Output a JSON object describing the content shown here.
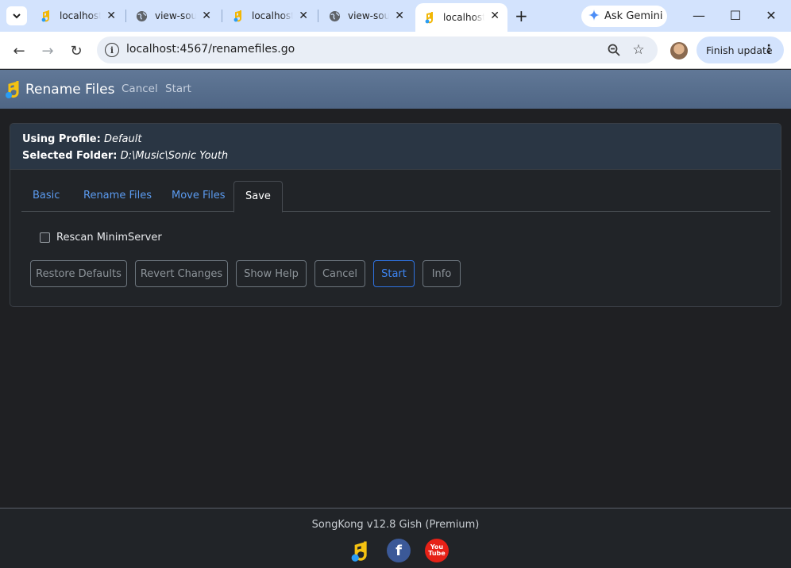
{
  "browser": {
    "tabs": [
      {
        "title": "localhost",
        "favicon": "songkong-favicon"
      },
      {
        "title": "view-sour",
        "favicon": "globe-icon"
      },
      {
        "title": "localhost",
        "favicon": "songkong-favicon"
      },
      {
        "title": "view-sour",
        "favicon": "globe-icon"
      },
      {
        "title": "localhost",
        "favicon": "songkong-favicon",
        "active": true
      }
    ],
    "gemini_label": "Ask Gemini",
    "url": "localhost:4567/renamefiles.go",
    "finish_update_label": "Finish update"
  },
  "app": {
    "title": "Rename Files",
    "nav": [
      "Cancel",
      "Start"
    ]
  },
  "profile": {
    "profile_label": "Using Profile:",
    "profile_value": "Default",
    "folder_label": "Selected Folder:",
    "folder_value": "D:\\Music\\Sonic Youth"
  },
  "tabs": [
    "Basic",
    "Rename Files",
    "Move Files",
    "Save"
  ],
  "active_tab": "Save",
  "options": {
    "rescan_label": "Rescan MinimServer",
    "rescan_checked": false
  },
  "buttons": [
    "Restore Defaults",
    "Revert Changes",
    "Show Help",
    "Cancel",
    "Start",
    "Info"
  ],
  "footer": {
    "version": "SongKong v12.8 Gish (Premium)",
    "youtube_text_1": "You",
    "youtube_text_2": "Tube"
  },
  "colors": {
    "accent": "#3d86f5",
    "appbar": "#5a7191",
    "background": "#1f2023"
  }
}
